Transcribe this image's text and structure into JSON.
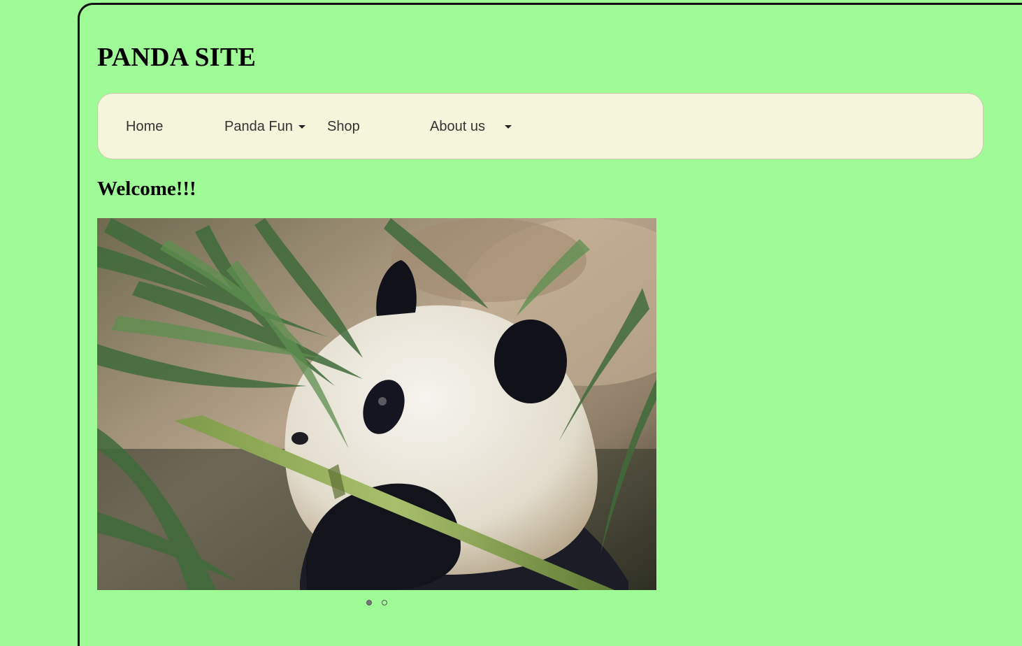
{
  "site": {
    "title": "PANDA SITE"
  },
  "nav": {
    "items": [
      {
        "label": "Home"
      },
      {
        "label": "Panda Fun",
        "dropdown": true
      },
      {
        "label": "Shop"
      },
      {
        "label": "About us",
        "dropdown": true
      }
    ]
  },
  "main": {
    "heading": "Welcome!!!"
  },
  "carousel": {
    "image": "giant-panda-eating-bamboo",
    "slide_count": 2,
    "active_index": 0
  },
  "colors": {
    "page_background": "#9ffb96",
    "navbar_background": "#f5f5dc",
    "text": "#000000"
  }
}
